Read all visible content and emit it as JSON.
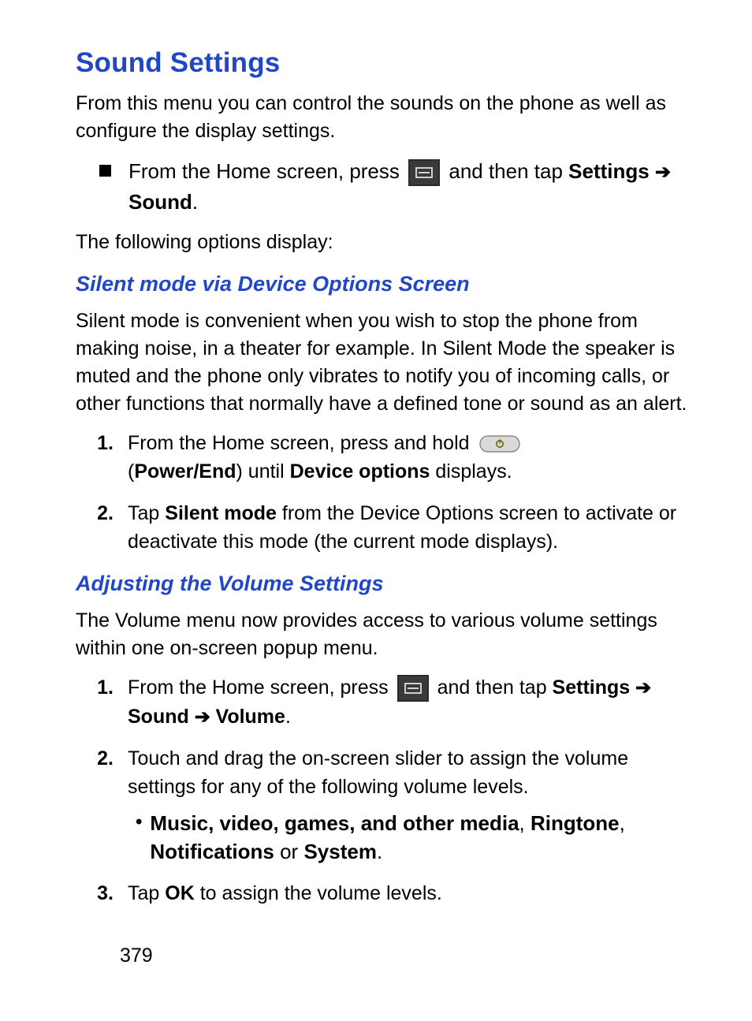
{
  "h1": "Sound Settings",
  "intro": "From this menu you can control the sounds on the phone as well as configure the display settings.",
  "sq1_pre": "From the Home screen, press ",
  "sq1_mid": " and then tap ",
  "settings_label": "Settings",
  "sound_label": "Sound",
  "volume_label": "Volume",
  "period": ".",
  "following": "The following options display:",
  "h2a": "Silent mode via Device Options Screen",
  "silent_intro": "Silent mode is convenient when you wish to stop the phone from making noise, in a theater for example. In Silent Mode the speaker is muted and the phone only vibrates to notify you of incoming calls, or other functions that normally have a defined tone or sound as an alert.",
  "silent_steps": {
    "s1_pre": "From the Home screen, press and hold ",
    "s1_paren_open": "(",
    "s1_powerend": "Power/End",
    "s1_paren_close": ") until ",
    "s1_devopts": "Device options",
    "s1_tail": " displays.",
    "s2_pre": "Tap ",
    "s2_silent": "Silent mode",
    "s2_tail": " from the Device Options screen to activate or deactivate this mode (the current mode displays)."
  },
  "h2b": "Adjusting the Volume Settings",
  "vol_intro": "The Volume menu now provides access to various volume settings within one on-screen popup menu.",
  "vol_steps": {
    "s1_pre": "From the Home screen, press ",
    "s1_mid": " and then tap ",
    "s2": "Touch and drag the on-screen slider to assign the volume settings for any of the following volume levels.",
    "bullet_bold1": "Music, video, games, and other media",
    "comma": ", ",
    "bullet_bold2": "Ringtone",
    "bullet_bold3": "Notifications",
    "bullet_or": " or ",
    "bullet_bold4": "System",
    "s3_pre": "Tap ",
    "s3_ok": "OK",
    "s3_tail": " to assign the volume levels."
  },
  "arrow": " ➔ ",
  "page_number": "379",
  "markers": {
    "n1": "1.",
    "n2": "2.",
    "n3": "3.",
    "dot": "•"
  }
}
